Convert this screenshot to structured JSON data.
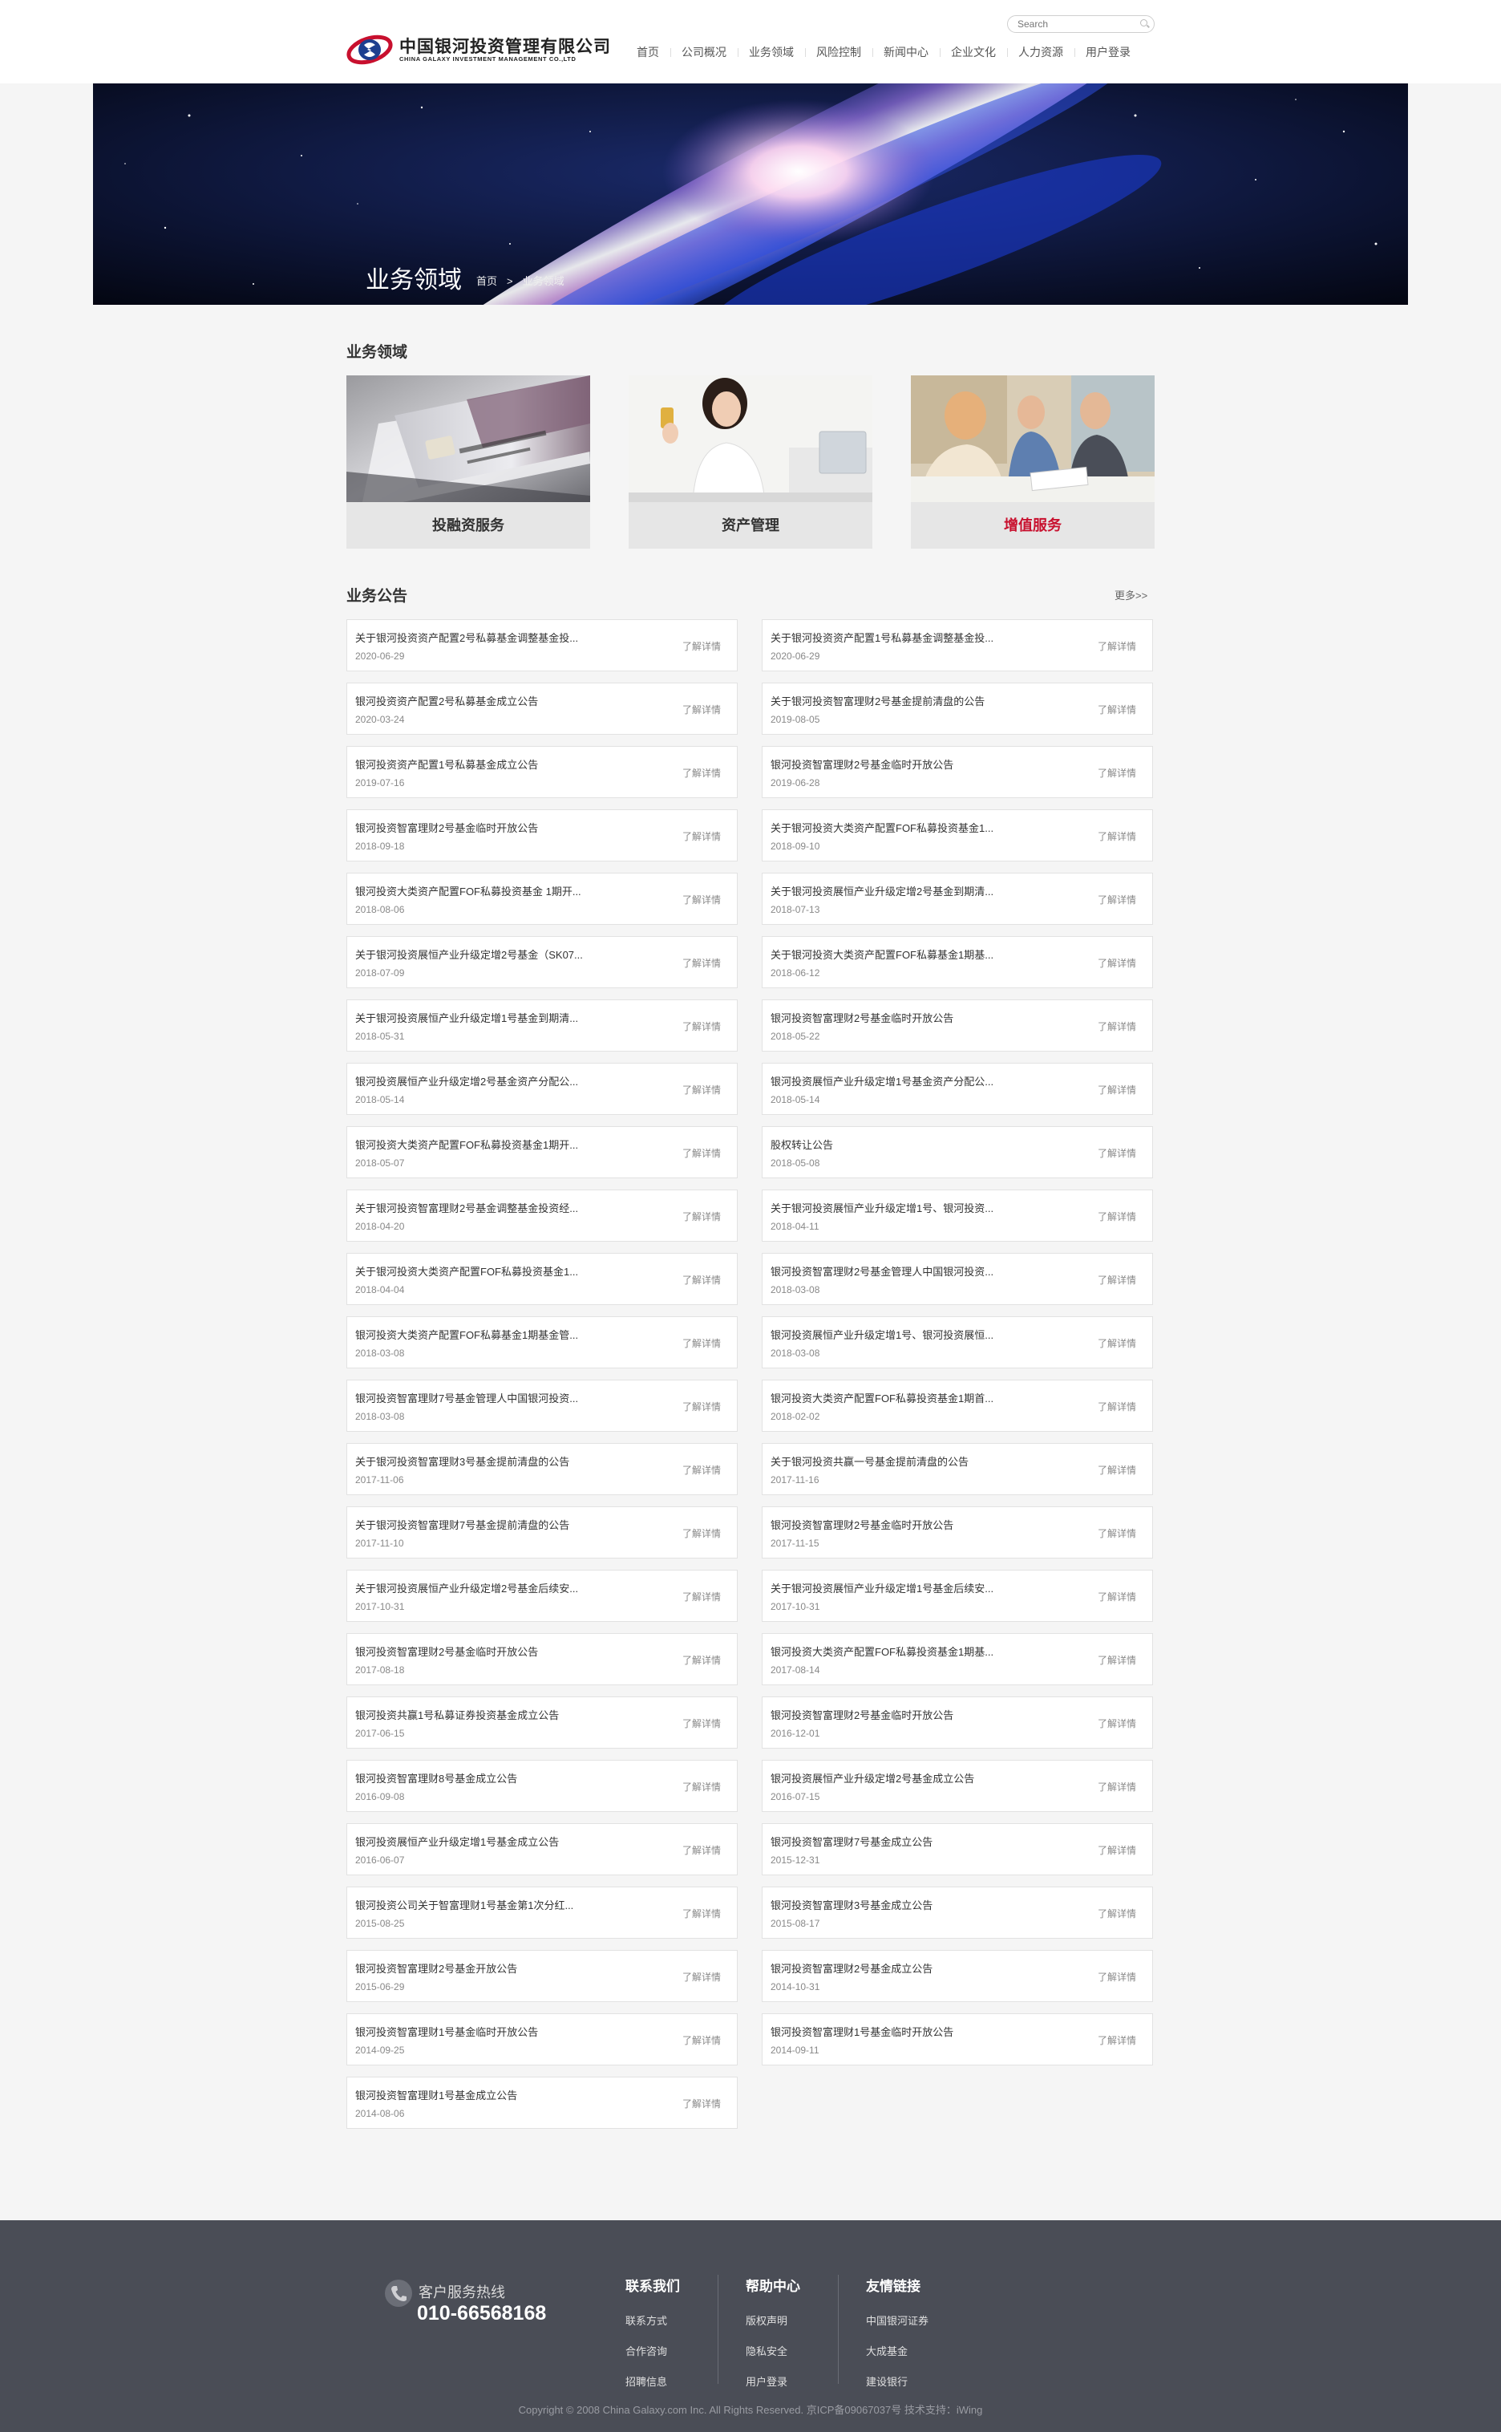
{
  "header": {
    "logo_cn": "中国银河投资管理有限公司",
    "logo_en": "CHINA GALAXY INVESTMENT MANAGEMENT CO.,LTD",
    "search_placeholder": "Search",
    "nav": [
      "首页",
      "公司概况",
      "业务领域",
      "风险控制",
      "新闻中心",
      "企业文化",
      "人力资源",
      "用户登录"
    ]
  },
  "banner": {
    "title": "业务领域",
    "breadcrumb": [
      "首页",
      ">",
      "业务领域"
    ]
  },
  "business": {
    "title": "业务领域",
    "cards": [
      {
        "label": "投融资服务",
        "active": false
      },
      {
        "label": "资产管理",
        "active": false
      },
      {
        "label": "增值服务",
        "active": true
      }
    ],
    "active_color": "#c8102e"
  },
  "announcements": {
    "title": "业务公告",
    "more": "更多>>",
    "detail_label": "了解详情",
    "left": [
      {
        "title": "关于银河投资资产配置2号私募基金调整基金投...",
        "date": "2020-06-29"
      },
      {
        "title": "银河投资资产配置2号私募基金成立公告",
        "date": "2020-03-24"
      },
      {
        "title": "银河投资资产配置1号私募基金成立公告",
        "date": "2019-07-16"
      },
      {
        "title": "银河投资智富理财2号基金临时开放公告",
        "date": "2018-09-18"
      },
      {
        "title": "银河投资大类资产配置FOF私募投资基金 1期开...",
        "date": "2018-08-06"
      },
      {
        "title": "关于银河投资展恒产业升级定增2号基金（SK07...",
        "date": "2018-07-09"
      },
      {
        "title": "关于银河投资展恒产业升级定增1号基金到期清...",
        "date": "2018-05-31"
      },
      {
        "title": "银河投资展恒产业升级定增2号基金资产分配公...",
        "date": "2018-05-14"
      },
      {
        "title": "银河投资大类资产配置FOF私募投资基金1期开...",
        "date": "2018-05-07"
      },
      {
        "title": "关于银河投资智富理财2号基金调整基金投资经...",
        "date": "2018-04-20"
      },
      {
        "title": "关于银河投资大类资产配置FOF私募投资基金1...",
        "date": "2018-04-04"
      },
      {
        "title": "银河投资大类资产配置FOF私募基金1期基金管...",
        "date": "2018-03-08"
      },
      {
        "title": "银河投资智富理财7号基金管理人中国银河投资...",
        "date": "2018-03-08"
      },
      {
        "title": "关于银河投资智富理财3号基金提前清盘的公告",
        "date": "2017-11-06"
      },
      {
        "title": "关于银河投资智富理财7号基金提前清盘的公告",
        "date": "2017-11-10"
      },
      {
        "title": "关于银河投资展恒产业升级定增2号基金后续安...",
        "date": "2017-10-31"
      },
      {
        "title": "银河投资智富理财2号基金临时开放公告",
        "date": "2017-08-18"
      },
      {
        "title": "银河投资共赢1号私募证券投资基金成立公告",
        "date": "2017-06-15"
      },
      {
        "title": "银河投资智富理财8号基金成立公告",
        "date": "2016-09-08"
      },
      {
        "title": "银河投资展恒产业升级定增1号基金成立公告",
        "date": "2016-06-07"
      },
      {
        "title": "银河投资公司关于智富理财1号基金第1次分红...",
        "date": "2015-08-25"
      },
      {
        "title": "银河投资智富理财2号基金开放公告",
        "date": "2015-06-29"
      },
      {
        "title": "银河投资智富理财1号基金临时开放公告",
        "date": "2014-09-25"
      },
      {
        "title": "银河投资智富理财1号基金成立公告",
        "date": "2014-08-06"
      }
    ],
    "right": [
      {
        "title": "关于银河投资资产配置1号私募基金调整基金投...",
        "date": "2020-06-29"
      },
      {
        "title": "关于银河投资智富理财2号基金提前清盘的公告",
        "date": "2019-08-05"
      },
      {
        "title": "银河投资智富理财2号基金临时开放公告",
        "date": "2019-06-28"
      },
      {
        "title": "关于银河投资大类资产配置FOF私募投资基金1...",
        "date": "2018-09-10"
      },
      {
        "title": "关于银河投资展恒产业升级定增2号基金到期清...",
        "date": "2018-07-13"
      },
      {
        "title": "关于银河投资大类资产配置FOF私募基金1期基...",
        "date": "2018-06-12"
      },
      {
        "title": "银河投资智富理财2号基金临时开放公告",
        "date": "2018-05-22"
      },
      {
        "title": "银河投资展恒产业升级定增1号基金资产分配公...",
        "date": "2018-05-14"
      },
      {
        "title": "股权转让公告",
        "date": "2018-05-08"
      },
      {
        "title": "关于银河投资展恒产业升级定增1号、银河投资...",
        "date": "2018-04-11"
      },
      {
        "title": "银河投资智富理财2号基金管理人中国银河投资...",
        "date": "2018-03-08"
      },
      {
        "title": "银河投资展恒产业升级定增1号、银河投资展恒...",
        "date": "2018-03-08"
      },
      {
        "title": "银河投资大类资产配置FOF私募投资基金1期首...",
        "date": "2018-02-02"
      },
      {
        "title": "关于银河投资共赢一号基金提前清盘的公告",
        "date": "2017-11-16"
      },
      {
        "title": "银河投资智富理财2号基金临时开放公告",
        "date": "2017-11-15"
      },
      {
        "title": "关于银河投资展恒产业升级定增1号基金后续安...",
        "date": "2017-10-31"
      },
      {
        "title": "银河投资大类资产配置FOF私募投资基金1期基...",
        "date": "2017-08-14"
      },
      {
        "title": "银河投资智富理财2号基金临时开放公告",
        "date": "2016-12-01"
      },
      {
        "title": "银河投资展恒产业升级定增2号基金成立公告",
        "date": "2016-07-15"
      },
      {
        "title": "银河投资智富理财7号基金成立公告",
        "date": "2015-12-31"
      },
      {
        "title": "银河投资智富理财3号基金成立公告",
        "date": "2015-08-17"
      },
      {
        "title": "银河投资智富理财2号基金成立公告",
        "date": "2014-10-31"
      },
      {
        "title": "银河投资智富理财1号基金临时开放公告",
        "date": "2014-09-11"
      }
    ]
  },
  "footer": {
    "hotline_label": "客户服务热线",
    "hotline": "010-66568168",
    "columns": [
      {
        "title": "联系我们",
        "links": [
          "联系方式",
          "合作咨询",
          "招聘信息"
        ]
      },
      {
        "title": "帮助中心",
        "links": [
          "版权声明",
          "隐私安全",
          "用户登录"
        ]
      },
      {
        "title": "友情链接",
        "links": [
          "中国银河证券",
          "大成基金",
          "建设银行"
        ]
      }
    ],
    "copyright": "Copyright © 2008 China Galaxy.com Inc. All Rights Reserved. 京ICP备09067037号 技术支持：iWing"
  },
  "icons": [
    "logo-icon",
    "search-icon",
    "phone-icon"
  ]
}
